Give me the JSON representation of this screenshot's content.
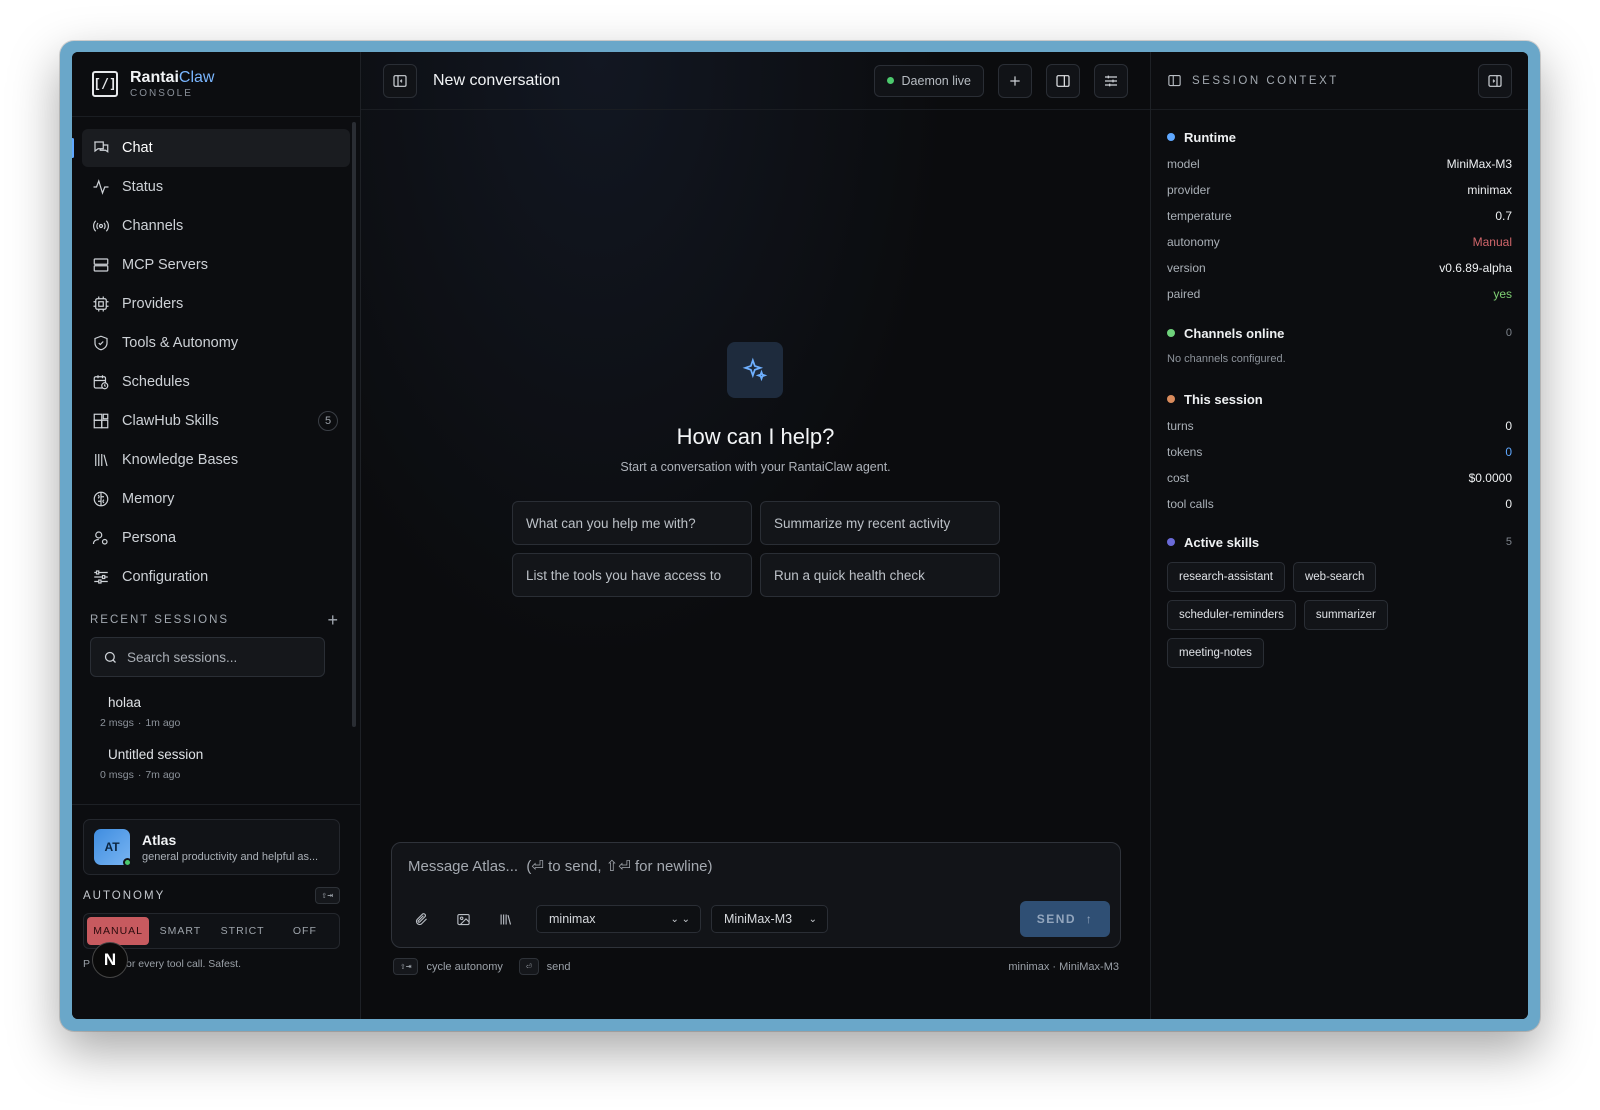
{
  "brand": {
    "name_main": "Rantai",
    "name_accent": "Claw",
    "subtitle": "CONSOLE",
    "logo": "[/]"
  },
  "nav": [
    {
      "label": "Chat",
      "icon": "chat-icon",
      "active": true
    },
    {
      "label": "Status",
      "icon": "activity-icon"
    },
    {
      "label": "Channels",
      "icon": "broadcast-icon"
    },
    {
      "label": "MCP Servers",
      "icon": "server-icon"
    },
    {
      "label": "Providers",
      "icon": "chip-icon"
    },
    {
      "label": "Tools & Autonomy",
      "icon": "shield-icon"
    },
    {
      "label": "Schedules",
      "icon": "calendar-clock-icon"
    },
    {
      "label": "ClawHub Skills",
      "icon": "blocks-icon",
      "badge": "5"
    },
    {
      "label": "Knowledge Bases",
      "icon": "library-icon"
    },
    {
      "label": "Memory",
      "icon": "brain-icon"
    },
    {
      "label": "Persona",
      "icon": "user-gear-icon"
    },
    {
      "label": "Configuration",
      "icon": "sliders-icon"
    }
  ],
  "recent": {
    "title": "RECENT SESSIONS",
    "add": "+",
    "search_placeholder": "Search sessions...",
    "sessions": [
      {
        "title": "holaa",
        "msgs": "2 msgs",
        "time": "1m ago"
      },
      {
        "title": "Untitled session",
        "msgs": "0 msgs",
        "time": "7m ago"
      }
    ]
  },
  "agent": {
    "initials": "AT",
    "name": "Atlas",
    "desc": "general productivity and helpful as..."
  },
  "autonomy": {
    "title": "AUTONOMY",
    "shortcut": "⇧⇥",
    "options": [
      "MANUAL",
      "SMART",
      "STRICT",
      "OFF"
    ],
    "active": "MANUAL",
    "note_prefix": "P",
    "note_suffix": "or every tool call. Safest.",
    "overlay_badge": "N"
  },
  "topbar": {
    "title": "New conversation",
    "daemon": "Daemon live"
  },
  "hero": {
    "title": "How can I help?",
    "subtitle": "Start a conversation with your RantaiClaw agent."
  },
  "suggestions": [
    "What can you help me with?",
    "Summarize my recent activity",
    "List the tools you have access to",
    "Run a quick health check"
  ],
  "composer": {
    "placeholder": "Message Atlas...  (⏎ to send, ⇧⏎ for newline)",
    "provider": "minimax",
    "model": "MiniMax-M3",
    "send": "SEND",
    "send_arrow": "↑"
  },
  "hints": {
    "cycle_key": "⇧⇥",
    "cycle_label": "cycle autonomy",
    "send_key": "⏎",
    "send_label": "send",
    "status": "minimax · MiniMax-M3"
  },
  "panel": {
    "title": "SESSION CONTEXT",
    "runtime": {
      "name": "Runtime",
      "color": "#5fa8ff",
      "rows": [
        {
          "k": "model",
          "v": "MiniMax-M3"
        },
        {
          "k": "provider",
          "v": "minimax"
        },
        {
          "k": "temperature",
          "v": "0.7"
        },
        {
          "k": "autonomy",
          "v": "Manual",
          "color": "#d1666b"
        },
        {
          "k": "version",
          "v": "v0.6.89-alpha"
        },
        {
          "k": "paired",
          "v": "yes",
          "color": "#7fcf73"
        }
      ]
    },
    "channels": {
      "name": "Channels online",
      "count": "0",
      "color": "#6fd27c",
      "note": "No channels configured."
    },
    "session": {
      "name": "This session",
      "color": "#d98b5c",
      "rows": [
        {
          "k": "turns",
          "v": "0"
        },
        {
          "k": "tokens",
          "v": "0",
          "color": "#5fa8ff"
        },
        {
          "k": "cost",
          "v": "$0.0000"
        },
        {
          "k": "tool calls",
          "v": "0"
        }
      ]
    },
    "skills": {
      "name": "Active skills",
      "count": "5",
      "color": "#6a6ad8",
      "items": [
        "research-assistant",
        "web-search",
        "scheduler-reminders",
        "summarizer",
        "meeting-notes"
      ]
    }
  }
}
